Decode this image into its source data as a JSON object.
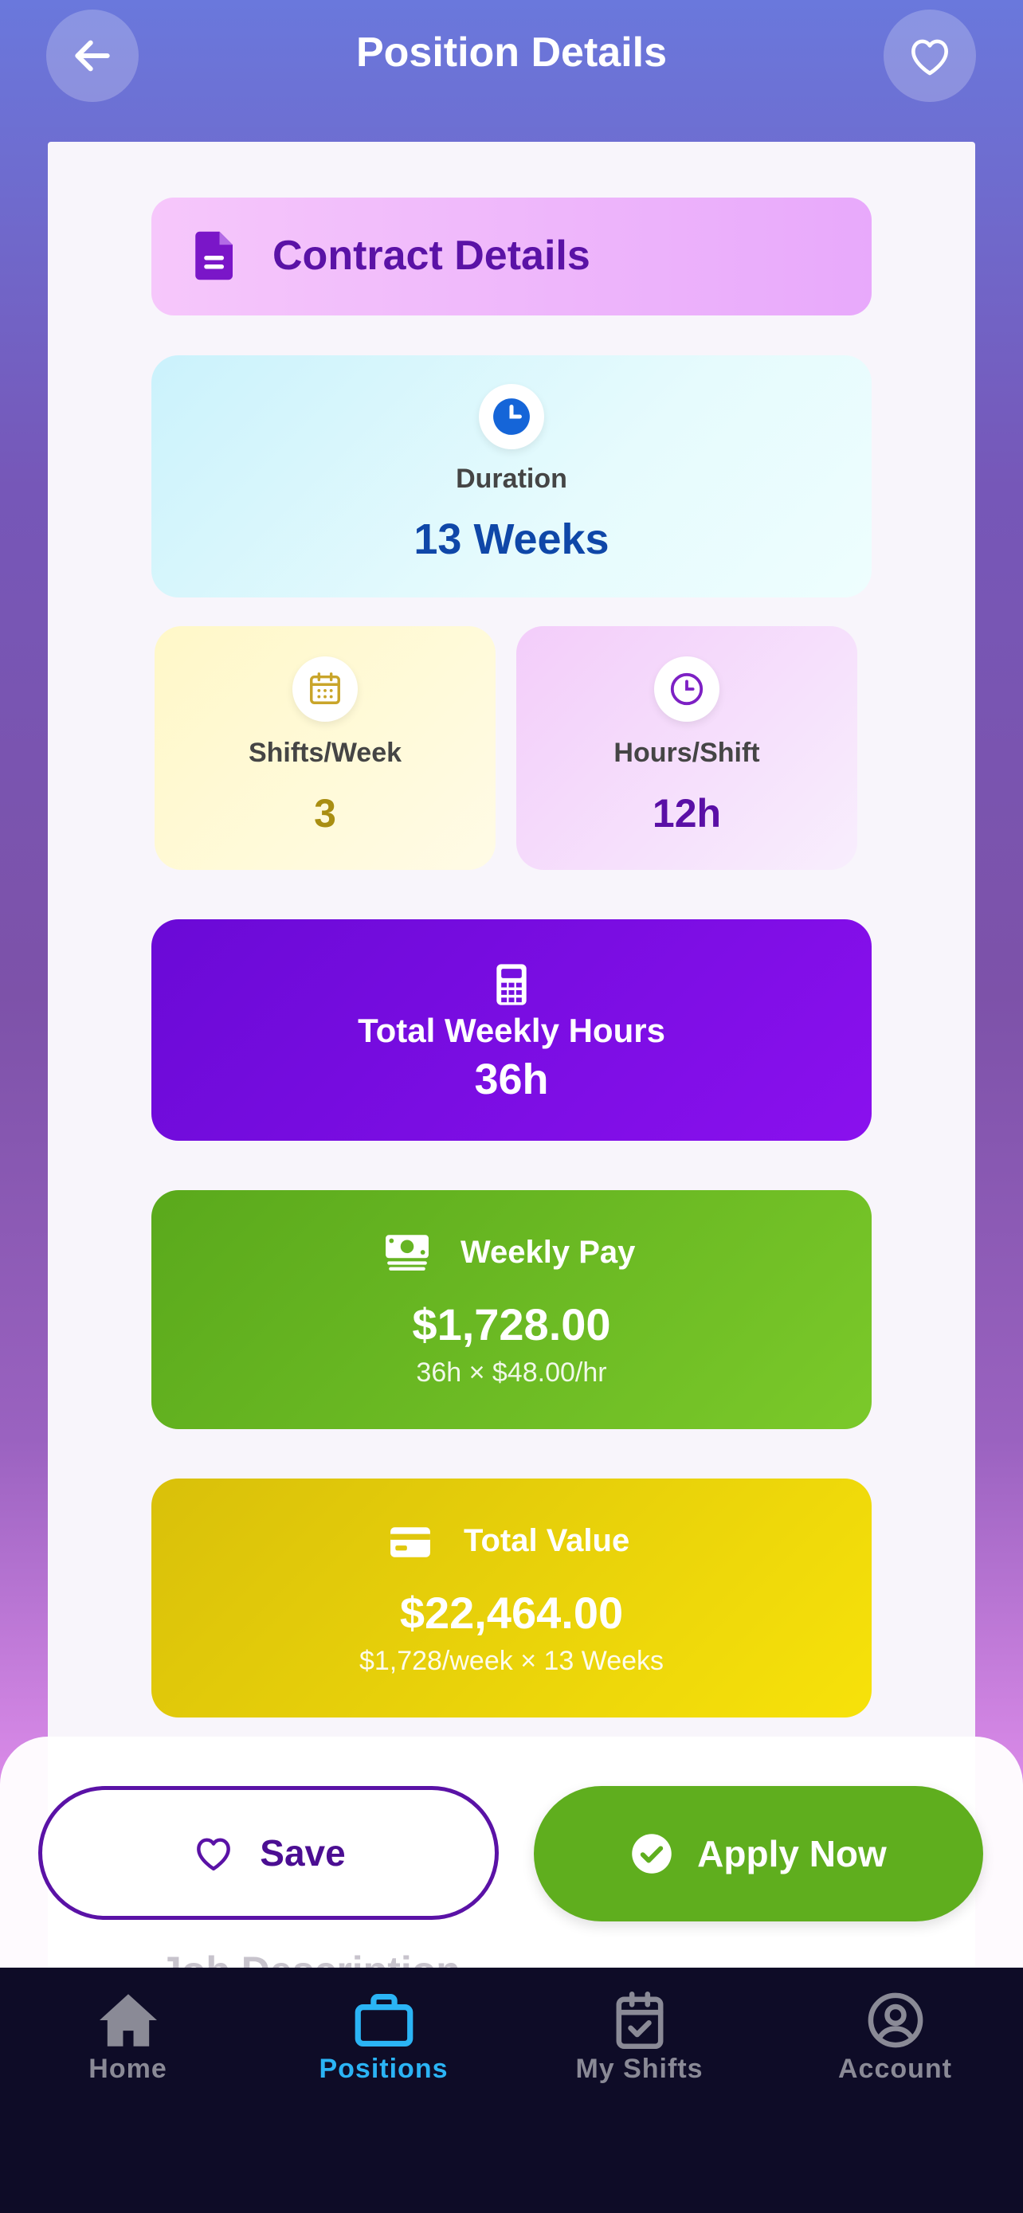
{
  "header": {
    "title": "Position Details",
    "back_icon": "arrow-left-icon",
    "favorite_icon": "heart-outline-icon"
  },
  "contract": {
    "heading": "Contract Details",
    "heading_icon": "document-icon"
  },
  "duration": {
    "label": "Duration",
    "value": "13 Weeks",
    "icon": "clock-filled-icon"
  },
  "shifts_per_week": {
    "label": "Shifts/Week",
    "value": "3",
    "icon": "calendar-icon"
  },
  "hours_per_shift": {
    "label": "Hours/Shift",
    "value": "12h",
    "icon": "clock-outline-icon"
  },
  "total_weekly_hours": {
    "label": "Total Weekly Hours",
    "value": "36h",
    "icon": "calculator-icon"
  },
  "weekly_pay": {
    "label": "Weekly Pay",
    "value": "$1,728.00",
    "detail": "36h × $48.00/hr",
    "icon": "money-icon"
  },
  "total_value": {
    "label": "Total Value",
    "value": "$22,464.00",
    "detail": "$1,728/week × 13 Weeks",
    "icon": "credit-card-icon"
  },
  "actions": {
    "save_label": "Save",
    "apply_label": "Apply Now"
  },
  "peek": {
    "text": "Job Description"
  },
  "tabbar": {
    "items": [
      {
        "label": "Home",
        "icon": "home-icon",
        "active": false
      },
      {
        "label": "Positions",
        "icon": "briefcase-icon",
        "active": true
      },
      {
        "label": "My Shifts",
        "icon": "calendar-check-icon",
        "active": false
      },
      {
        "label": "Account",
        "icon": "user-circle-icon",
        "active": false
      }
    ]
  },
  "colors": {
    "accent_purple": "#5a12a6",
    "apply_green": "#5fae1e",
    "tab_active": "#2bb4f5",
    "tab_inactive": "#8a8a96"
  }
}
